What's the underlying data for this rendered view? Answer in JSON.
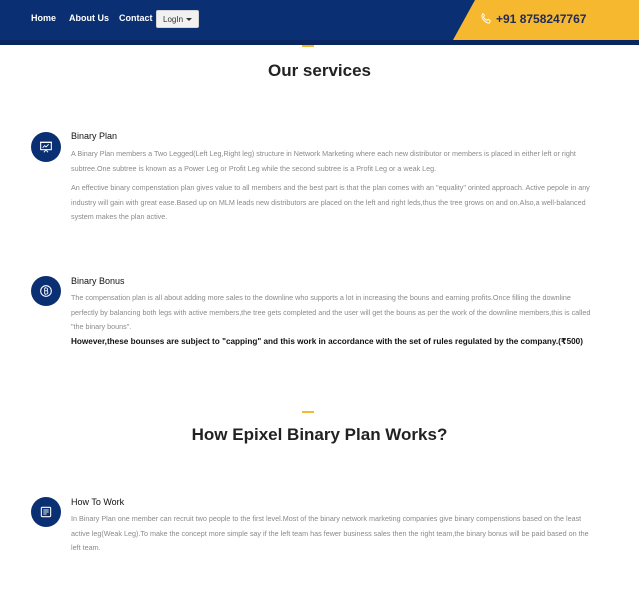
{
  "nav": {
    "home": "Home",
    "about": "About Us",
    "contact": "Contact",
    "login": "LogIn",
    "phone": "+91 8758247767"
  },
  "sections": {
    "services_title": "Our services",
    "works_title": "How Epixel Binary Plan Works?"
  },
  "items": {
    "binary_plan": {
      "title": "Binary Plan",
      "p1": "A Binary Plan members a Two Legged(Left Leg,Right leg) structure in Network Marketing where each new distributor or members is placed in either left or right subtree.One subtree is known as a Power Leg or Profit Leg while the second subtree is a Profit Leg or a weak Leg.",
      "p2": "An effective binary compenstation plan gives value to all members and the best part is that the plan comes with an \"equality\" orinted approach. Active pepole in any industry will gain with great ease.Based up on MLM leads new distributors are placed on the left and right leds,thus the tree grows on and on.Also,a well-balanced system makes the plan active."
    },
    "binary_bonus": {
      "title": "Binary Bonus",
      "p1": "The compensation plan is all about adding more sales to the downline who supports a lot in increasing the bouns and earning profits.Once filling the downline perfectly by balancing both legs with active members,the tree gets completed and the user will get the bouns as per the work of the downline members,this is called \"the binary bouns\".",
      "p2": "However,these bounses are subject to \"capping\" and this work in accordance with the set of rules regulated by the company.(₹500)"
    },
    "how_to_work": {
      "title": "How To Work",
      "p1": "In Binary Plan one member can recruit two people to the first level.Most of the binary network marketing companies give binary compenstions based on the least active leg(Weak Leg).To make the concept more simple say if the left team has fewer business sales then the right team,the binary bonus will be paid based on the left team."
    }
  },
  "icons": {
    "phone": "phone-icon",
    "plan": "presentation-icon",
    "bonus": "bitcoin-icon",
    "work": "document-icon"
  },
  "colors": {
    "navy": "#0b2f73",
    "accent": "#f5b82e",
    "text_muted": "#8a8a8a"
  }
}
